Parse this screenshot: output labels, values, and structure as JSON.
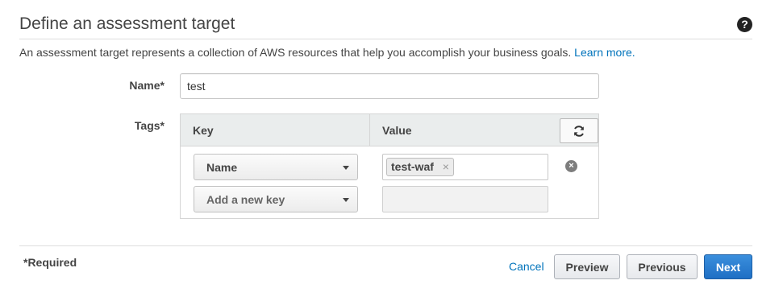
{
  "header": {
    "title": "Define an assessment target",
    "help_icon": "?"
  },
  "description": {
    "text": "An assessment target represents a collection of AWS resources that help you accomplish your business goals.",
    "link": "Learn more."
  },
  "form": {
    "name_label": "Name*",
    "name_value": "test",
    "tags_label": "Tags*",
    "tags": {
      "key_header": "Key",
      "value_header": "Value",
      "refresh_icon": "refresh-icon",
      "rows": [
        {
          "key": "Name",
          "value_chip": "test-waf",
          "chip_remove": "×",
          "row_remove": "×"
        },
        {
          "key": "Add a new key",
          "value": ""
        }
      ]
    }
  },
  "footer": {
    "required_note": "*Required",
    "cancel": "Cancel",
    "preview": "Preview",
    "previous": "Previous",
    "next": "Next"
  },
  "colors": {
    "link": "#0073bb",
    "primary_button": "#1f6fc4",
    "header_bg": "#eaeded"
  }
}
